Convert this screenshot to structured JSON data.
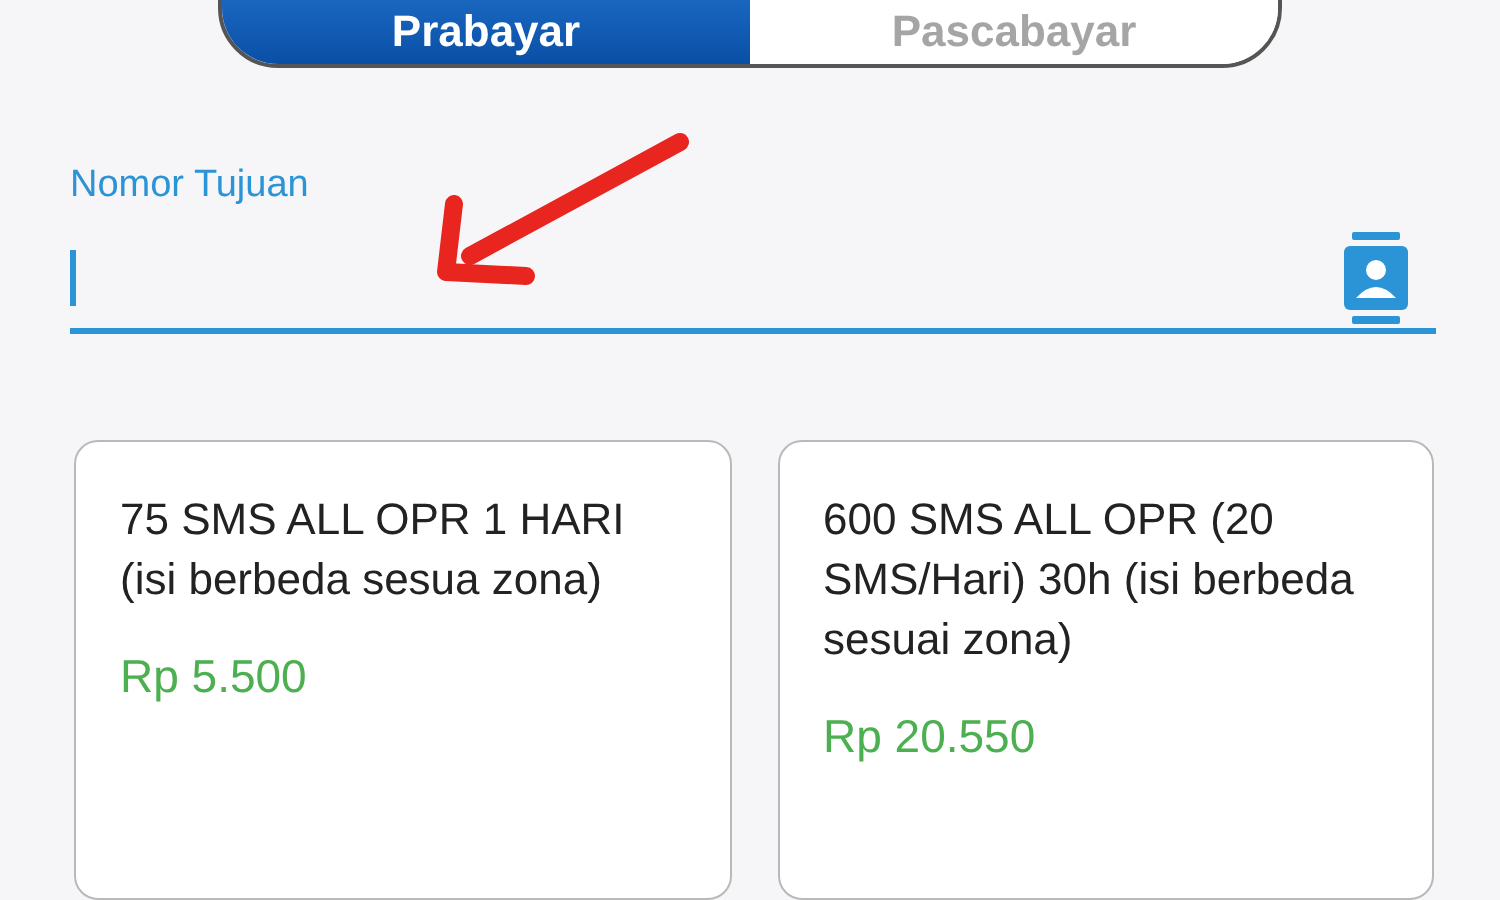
{
  "tabs": [
    {
      "label": "Prabayar",
      "selected": true
    },
    {
      "label": "Pascabayar",
      "selected": false
    }
  ],
  "phone_field": {
    "label": "Nomor Tujuan",
    "focused": true
  },
  "packages": [
    {
      "name": "75 SMS ALL OPR 1 HARI (isi berbeda sesua zona)",
      "price": "Rp 5.500"
    },
    {
      "name": "600 SMS ALL OPR (20 SMS/Hari) 30h (isi berbeda sesuai zona)",
      "price": "Rp 20.550"
    }
  ]
}
